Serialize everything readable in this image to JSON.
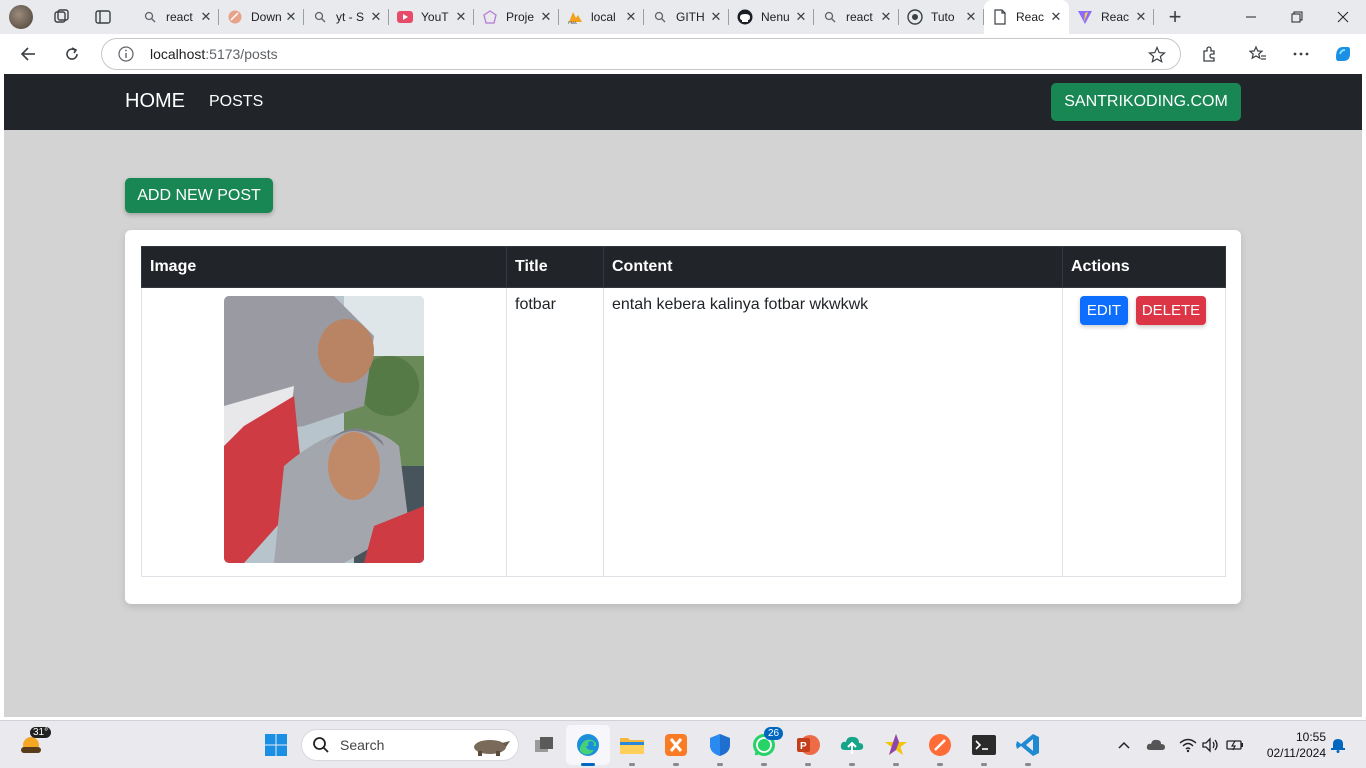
{
  "browser": {
    "tabs": [
      {
        "label": "react",
        "icon": "search-icon"
      },
      {
        "label": "Down",
        "icon": "app-icon"
      },
      {
        "label": "yt - S",
        "icon": "search-icon"
      },
      {
        "label": "YouT",
        "icon": "youtube-icon"
      },
      {
        "label": "Proje",
        "icon": "project-icon"
      },
      {
        "label": "local",
        "icon": "phpmyadmin-icon"
      },
      {
        "label": "GITH",
        "icon": "search-icon"
      },
      {
        "label": "Nenu",
        "icon": "github-icon"
      },
      {
        "label": "react",
        "icon": "search-icon"
      },
      {
        "label": "Tuto",
        "icon": "site-icon"
      },
      {
        "label": "Reac",
        "icon": "page-icon",
        "active": true
      },
      {
        "label": "Reac",
        "icon": "vite-icon"
      }
    ],
    "address": {
      "host": "localhost",
      "path": ":5173/posts"
    }
  },
  "app": {
    "nav": {
      "brand": "HOME",
      "link": "POSTS",
      "site_button": "SANTRIKODING.COM"
    },
    "add_button": "ADD NEW POST",
    "table": {
      "headers": [
        "Image",
        "Title",
        "Content",
        "Actions"
      ],
      "rows": [
        {
          "title": "fotbar",
          "content": "entah kebera kalinya fotbar wkwkwk",
          "edit": "EDIT",
          "delete": "DELETE"
        }
      ]
    }
  },
  "taskbar": {
    "weather_temp": "31°",
    "search_placeholder": "Search",
    "whatsapp_badge": "26",
    "time": "10:55",
    "date": "02/11/2024"
  },
  "colors": {
    "navbar": "#212529",
    "success": "#198754",
    "primary": "#0d6efd",
    "danger": "#dc3545",
    "page_bg": "#d3d3d3"
  }
}
